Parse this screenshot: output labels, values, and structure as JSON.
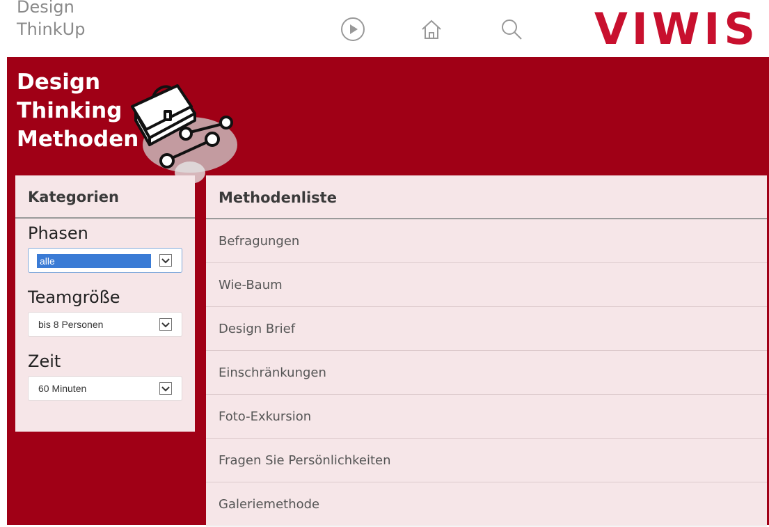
{
  "app_title": {
    "line1": "Design",
    "line2": "ThinkUp"
  },
  "brand": {
    "name": "VIWIS",
    "color": "#c8102e"
  },
  "top_icons": [
    "play-circle-icon",
    "home-icon",
    "search-icon"
  ],
  "hero": {
    "title_lines": [
      "Design",
      "Thinking",
      "Methoden"
    ],
    "art_icon": "toolbox-wrenches-icon"
  },
  "colors": {
    "banner": "#a00016",
    "panel": "#f6e6e8"
  },
  "sidebar": {
    "header": "Kategorien",
    "filters": [
      {
        "label": "Phasen",
        "value": "alle"
      },
      {
        "label": "Teamgröße",
        "value": "bis 8 Personen"
      },
      {
        "label": "Zeit",
        "value": "60 Minuten"
      }
    ]
  },
  "main": {
    "header": "Methodenliste",
    "items": [
      "Befragungen",
      "Wie-Baum",
      "Design Brief",
      "Einschränkungen",
      "Foto-Exkursion",
      "Fragen Sie Persönlichkeiten",
      "Galeriemethode"
    ]
  }
}
